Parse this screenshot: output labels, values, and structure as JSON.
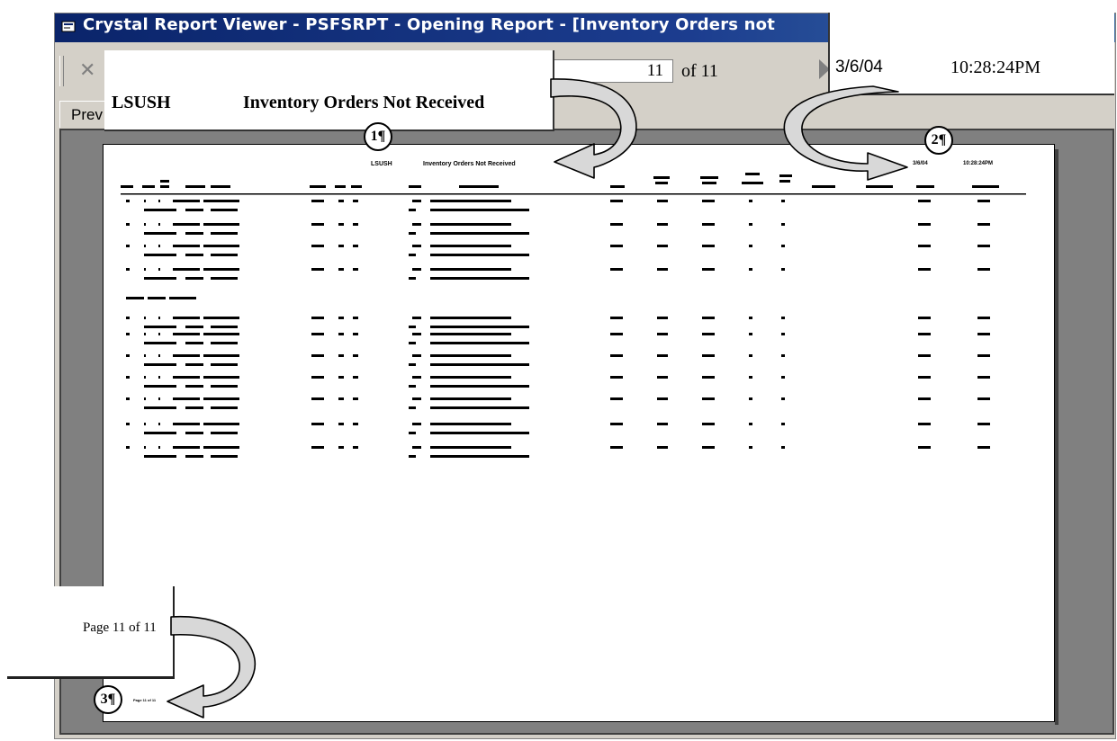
{
  "window": {
    "title": "Crystal Report Viewer - PSFSRPT - Opening Report - [Inventory Orders not"
  },
  "toolbar": {
    "close_icon": "✕",
    "page_current": "11",
    "page_of": "of 11",
    "next_icon": "nav-next-icon"
  },
  "tabs": {
    "preview": "Prev"
  },
  "report": {
    "code": "LSUSH",
    "title": "Inventory Orders Not Received",
    "date": "3/6/04",
    "time": "10:28:24PM",
    "footer": "Page 11 of 11"
  },
  "callouts": {
    "c1_code": "LSUSH",
    "c1_title": "Inventory Orders Not Received",
    "c2_date": "3/6/04",
    "c2_time": "10:28:24PM",
    "c3_text": "Page 11 of 11",
    "marker_1": "1¶",
    "marker_2": "2¶",
    "marker_3": "3¶"
  },
  "colors": {
    "titlebar": "#0a246a",
    "chrome": "#d4d0c8",
    "viewer_bg": "#808080"
  }
}
